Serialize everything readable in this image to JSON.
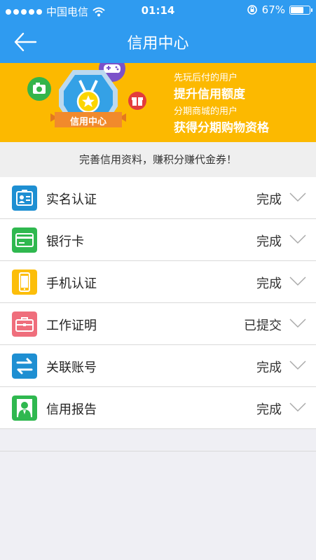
{
  "status_bar": {
    "carrier": "中国电信",
    "time": "01:14",
    "battery": "67%",
    "battery_level": 0.67
  },
  "nav": {
    "title": "信用中心",
    "back_icon": "back-arrow-icon"
  },
  "banner": {
    "badge_label": "信用中心",
    "line1": "先玩后付的用户",
    "line2": "提升信用额度",
    "line3": "分期商城的用户",
    "line4": "获得分期购物资格",
    "colors": {
      "bg": "#fcb900",
      "badge": "#34a1e6"
    }
  },
  "notice": "完善信用资料，赚积分赚代金券！",
  "items": [
    {
      "label": "实名认证",
      "status": "完成",
      "icon": "id-card-icon",
      "color": "#1e8fd2"
    },
    {
      "label": "银行卡",
      "status": "完成",
      "icon": "bank-card-icon",
      "color": "#2fb84f"
    },
    {
      "label": "手机认证",
      "status": "完成",
      "icon": "mobile-phone-icon",
      "color": "#fcbe0a"
    },
    {
      "label": "工作证明",
      "status": "已提交",
      "icon": "briefcase-icon",
      "color": "#ef6e7c"
    },
    {
      "label": "关联账号",
      "status": "完成",
      "icon": "link-arrows-icon",
      "color": "#1e8fd2"
    },
    {
      "label": "信用报告",
      "status": "完成",
      "icon": "user-report-icon",
      "color": "#2fb84f"
    }
  ]
}
